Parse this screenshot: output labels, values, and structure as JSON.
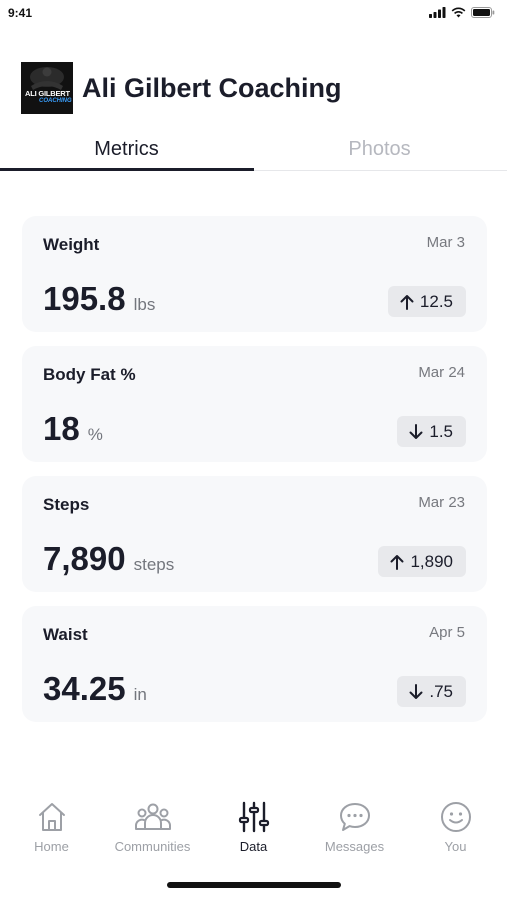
{
  "status": {
    "time": "9:41"
  },
  "header": {
    "logo_text_line1": "ALI GILBERT",
    "logo_text_line2": "COACHING",
    "title": "Ali Gilbert Coaching"
  },
  "tabs": [
    {
      "label": "Metrics",
      "active": true
    },
    {
      "label": "Photos",
      "active": false
    }
  ],
  "metrics": [
    {
      "title": "Weight",
      "date": "Mar 3",
      "value": "195.8",
      "unit": "lbs",
      "direction": "up",
      "change": "12.5"
    },
    {
      "title": "Body Fat %",
      "date": "Mar 24",
      "value": "18",
      "unit": "%",
      "direction": "down",
      "change": "1.5"
    },
    {
      "title": "Steps",
      "date": "Mar 23",
      "value": "7,890",
      "unit": "steps",
      "direction": "up",
      "change": "1,890"
    },
    {
      "title": "Waist",
      "date": "Apr 5",
      "value": "34.25",
      "unit": "in",
      "direction": "down",
      "change": ".75"
    }
  ],
  "nav": [
    {
      "label": "Home",
      "icon": "home-icon",
      "active": false
    },
    {
      "label": "Communities",
      "icon": "communities-icon",
      "active": false
    },
    {
      "label": "Data",
      "icon": "sliders-icon",
      "active": true
    },
    {
      "label": "Messages",
      "icon": "chat-bubble-icon",
      "active": false
    },
    {
      "label": "You",
      "icon": "smiley-icon",
      "active": false
    }
  ],
  "colors": {
    "text_primary": "#1b1d2a",
    "text_muted": "#9da0a6",
    "card_bg": "#f7f8fa",
    "pill_bg": "#e8e9ec"
  }
}
